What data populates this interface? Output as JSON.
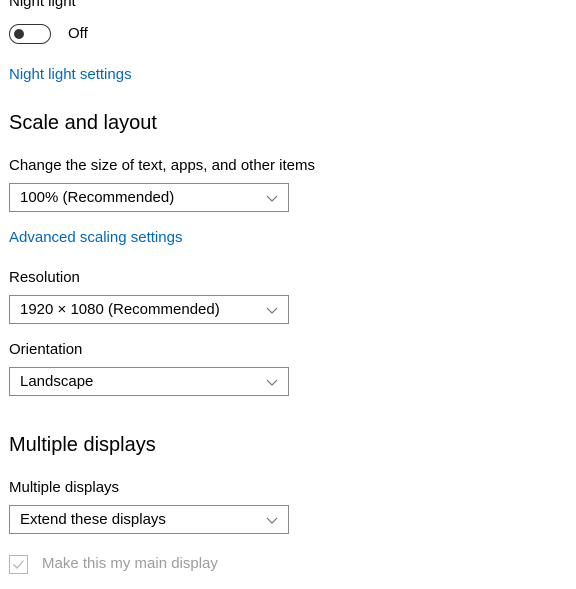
{
  "page": {
    "background_color": "#ffffff",
    "accent_color": "#0067c0",
    "text_color": "#000000",
    "disabled_text_color": "#9d9d9d",
    "control_border_color": "#8a8a8a"
  },
  "night_light": {
    "heading": "Night light",
    "toggle_state_label": "Off",
    "toggle_on": false,
    "settings_link": "Night light settings"
  },
  "scale_and_layout": {
    "heading": "Scale and layout",
    "scale": {
      "label": "Change the size of text, apps, and other items",
      "value": "100% (Recommended)"
    },
    "advanced_scaling_link": "Advanced scaling settings",
    "resolution": {
      "label": "Resolution",
      "value": "1920 × 1080 (Recommended)"
    },
    "orientation": {
      "label": "Orientation",
      "value": "Landscape"
    }
  },
  "multiple_displays": {
    "heading": "Multiple displays",
    "mode": {
      "label": "Multiple displays",
      "value": "Extend these displays"
    },
    "main_display_checkbox": {
      "label": "Make this my main display",
      "checked": true,
      "disabled": true
    }
  },
  "icons": {
    "chevron": "chevron-down-icon",
    "check": "check-icon"
  }
}
